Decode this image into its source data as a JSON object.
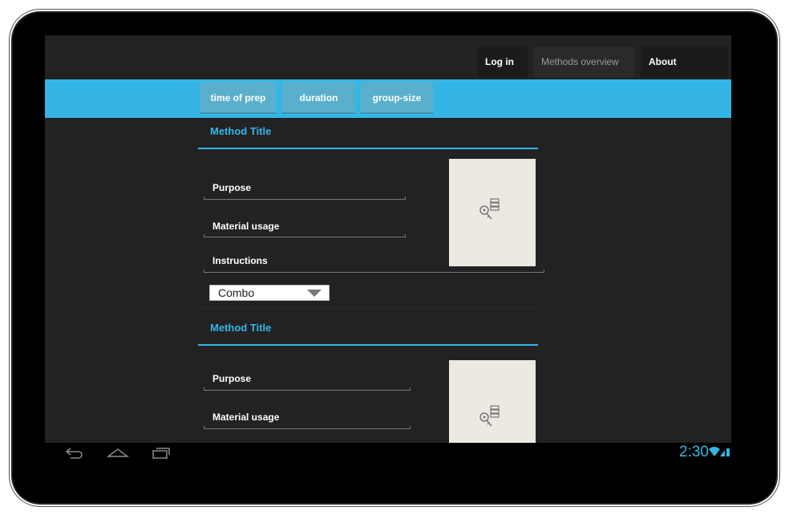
{
  "nav": {
    "login_label": "Log in",
    "methods_label": "Methods overview",
    "about_label": "About"
  },
  "filters": [
    {
      "label": "time of prep"
    },
    {
      "label": "duration"
    },
    {
      "label": "group-size"
    }
  ],
  "methods": [
    {
      "title": "Method Title",
      "purpose_label": "Purpose",
      "material_label": "Material usage",
      "instructions_label": "Instructions",
      "combo_value": "Combo",
      "image_icon": "key-list-icon"
    },
    {
      "title": "Method Title",
      "purpose_label": "Purpose",
      "material_label": "Material usage",
      "image_icon": "key-list-icon"
    }
  ],
  "system_bar": {
    "time": "2:30",
    "icons": [
      "back-icon",
      "home-icon",
      "recent-apps-icon",
      "wifi-icon",
      "signal-icon",
      "battery-icon"
    ]
  },
  "colors": {
    "accent": "#34b5e5",
    "screen_bg": "#222222",
    "image_placeholder": "#ece9e3"
  }
}
